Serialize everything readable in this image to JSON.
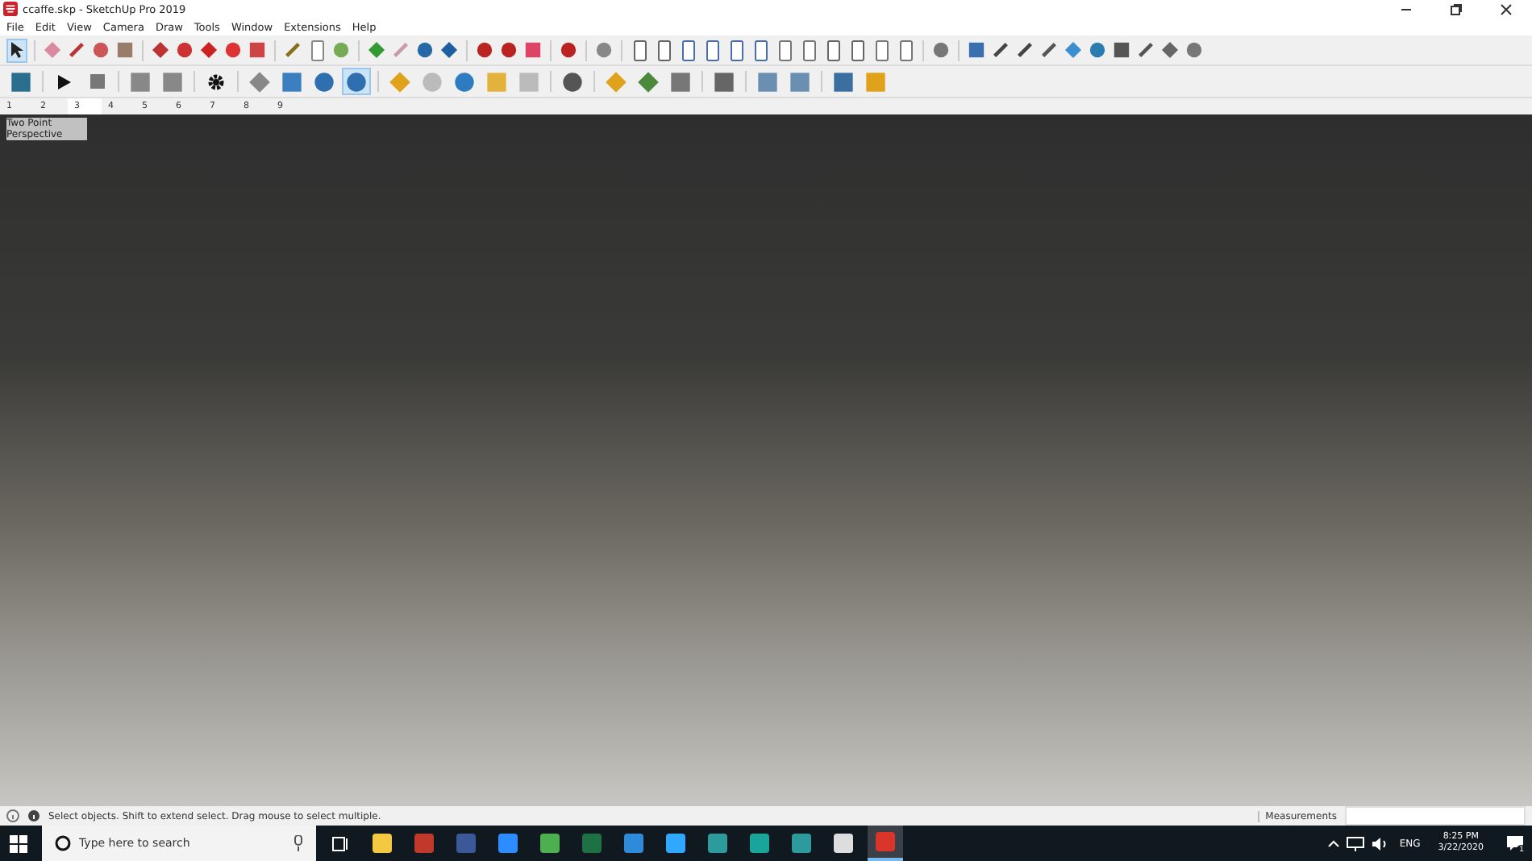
{
  "window": {
    "title": "ccaffe.skp - SketchUp Pro 2019"
  },
  "menu": [
    "File",
    "Edit",
    "View",
    "Camera",
    "Draw",
    "Tools",
    "Window",
    "Extensions",
    "Help"
  ],
  "scene_tabs": [
    {
      "label": "1",
      "selected": false
    },
    {
      "label": "2",
      "selected": false
    },
    {
      "label": "3",
      "selected": true
    },
    {
      "label": "4",
      "selected": false
    },
    {
      "label": "5",
      "selected": false
    },
    {
      "label": "6",
      "selected": false
    },
    {
      "label": "7",
      "selected": false
    },
    {
      "label": "8",
      "selected": false
    },
    {
      "label": "9",
      "selected": false
    }
  ],
  "viewport": {
    "camera_label": "Two Point Perspective"
  },
  "status_bar": {
    "hint": "Select objects. Shift to extend select. Drag mouse to select multiple.",
    "measurements_label": "Measurements"
  },
  "taskbar": {
    "search": {
      "placeholder": "Type here to search"
    },
    "language": "ENG",
    "time": "8:25 PM",
    "date": "3/22/2020",
    "notifications": "1"
  }
}
